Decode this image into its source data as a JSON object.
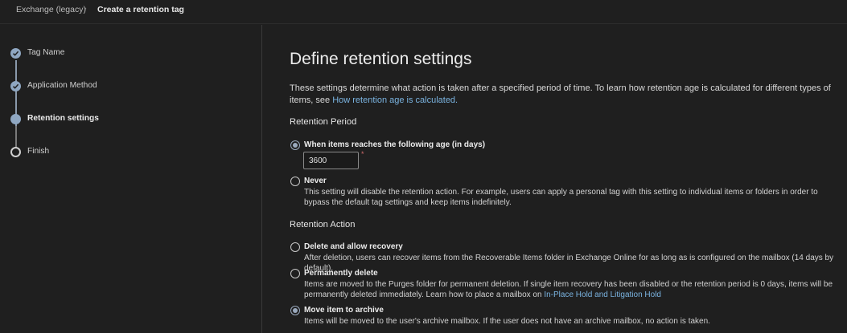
{
  "breadcrumb": {
    "parent": "Exchange (legacy)",
    "separator": "›",
    "current": "Create a retention tag"
  },
  "wizard": {
    "steps": [
      {
        "label": "Tag Name",
        "state": "done"
      },
      {
        "label": "Application Method",
        "state": "done"
      },
      {
        "label": "Retention settings",
        "state": "current"
      },
      {
        "label": "Finish",
        "state": "pending"
      }
    ]
  },
  "page": {
    "title": "Define retention settings",
    "description": "These settings determine what action is taken after a specified period of time. To learn how retention age is calculated for different types of items, see ",
    "description_link": "How retention age is calculated."
  },
  "retention_period": {
    "heading": "Retention Period",
    "option_age": {
      "label": "When items reaches the following age (in days)",
      "selected": true
    },
    "age_value": "3600",
    "required_mark": "*",
    "option_never": {
      "label": "Never",
      "selected": false,
      "description": "This setting will disable the retention action. For example, users can apply a personal tag with this setting to individual items or folders in order to bypass the default tag settings and keep items indefinitely."
    }
  },
  "retention_action": {
    "heading": "Retention Action",
    "options": [
      {
        "label": "Delete and allow recovery",
        "selected": false,
        "description": "After deletion, users can recover items from the Recoverable Items folder in Exchange Online for as long as is configured on the mailbox (14 days by default)."
      },
      {
        "label": "Permanently delete",
        "selected": false,
        "description": "Items are moved to the Purges folder for permanent deletion. If single item recovery has been disabled or the retention period is 0 days, items will be permanently deleted immediately. Learn how to place a mailbox on ",
        "description_link": "In-Place Hold and Litigation Hold"
      },
      {
        "label": "Move item to archive",
        "selected": true,
        "description": "Items will be moved to the user's archive mailbox. If the user does not have an archive mailbox, no action is taken."
      }
    ]
  },
  "icons": {
    "step_done": "checkmark-icon",
    "breadcrumb_separator": "chevron-right-icon"
  },
  "colors": {
    "background": "#1f1f1f",
    "accent": "#8fa7c2",
    "link": "#7ab3e0"
  }
}
